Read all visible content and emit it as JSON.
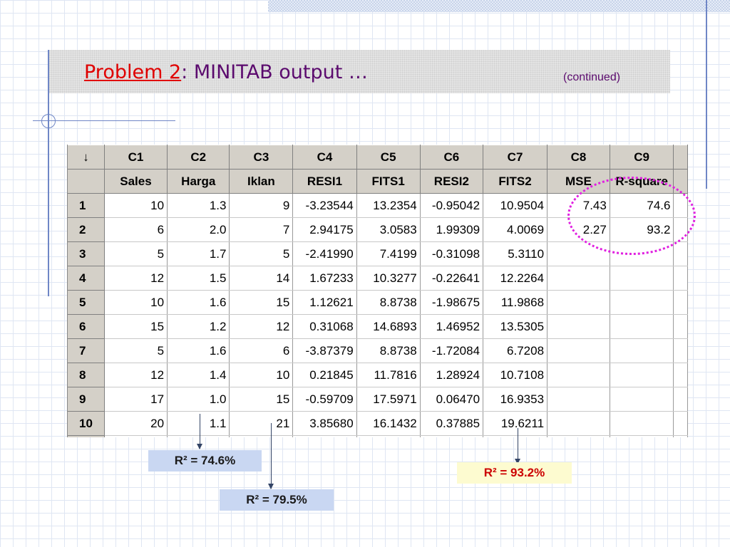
{
  "slide": {
    "title_link": "Problem 2",
    "title_rest": ": MINITAB output …",
    "continued": "(continued)"
  },
  "worksheet": {
    "corner": "↓",
    "columns": [
      "C1",
      "C2",
      "C3",
      "C4",
      "C5",
      "C6",
      "C7",
      "C8",
      "C9"
    ],
    "names": [
      "Sales",
      "Harga",
      "Iklan",
      "RESI1",
      "FITS1",
      "RESI2",
      "FITS2",
      "MSE",
      "R-square"
    ],
    "rows": [
      {
        "num": "1",
        "cells": [
          "10",
          "1.3",
          "9",
          "-3.23544",
          "13.2354",
          "-0.95042",
          "10.9504",
          "7.43",
          "74.6"
        ]
      },
      {
        "num": "2",
        "cells": [
          "6",
          "2.0",
          "7",
          "2.94175",
          "3.0583",
          "1.99309",
          "4.0069",
          "2.27",
          "93.2"
        ]
      },
      {
        "num": "3",
        "cells": [
          "5",
          "1.7",
          "5",
          "-2.41990",
          "7.4199",
          "-0.31098",
          "5.3110",
          "",
          ""
        ]
      },
      {
        "num": "4",
        "cells": [
          "12",
          "1.5",
          "14",
          "1.67233",
          "10.3277",
          "-0.22641",
          "12.2264",
          "",
          ""
        ]
      },
      {
        "num": "5",
        "cells": [
          "10",
          "1.6",
          "15",
          "1.12621",
          "8.8738",
          "-1.98675",
          "11.9868",
          "",
          ""
        ]
      },
      {
        "num": "6",
        "cells": [
          "15",
          "1.2",
          "12",
          "0.31068",
          "14.6893",
          "1.46952",
          "13.5305",
          "",
          ""
        ]
      },
      {
        "num": "7",
        "cells": [
          "5",
          "1.6",
          "6",
          "-3.87379",
          "8.8738",
          "-1.72084",
          "6.7208",
          "",
          ""
        ]
      },
      {
        "num": "8",
        "cells": [
          "12",
          "1.4",
          "10",
          "0.21845",
          "11.7816",
          "1.28924",
          "10.7108",
          "",
          ""
        ]
      },
      {
        "num": "9",
        "cells": [
          "17",
          "1.0",
          "15",
          "-0.59709",
          "17.5971",
          "0.06470",
          "16.9353",
          "",
          ""
        ]
      },
      {
        "num": "10",
        "cells": [
          "20",
          "1.1",
          "21",
          "3.85680",
          "16.1432",
          "0.37885",
          "19.6211",
          "",
          ""
        ]
      }
    ]
  },
  "annotations": {
    "r2_harga": "R² = 74.6%",
    "r2_iklan": "R² = 79.5%",
    "r2_fits2": "R² = 93.2%"
  },
  "colors": {
    "title": "#5b0a6e",
    "link": "#e00000",
    "highlight_ellipse": "#e020e0",
    "blue_box": "#c9d7f2",
    "yellow_box": "#fdfbd0"
  }
}
